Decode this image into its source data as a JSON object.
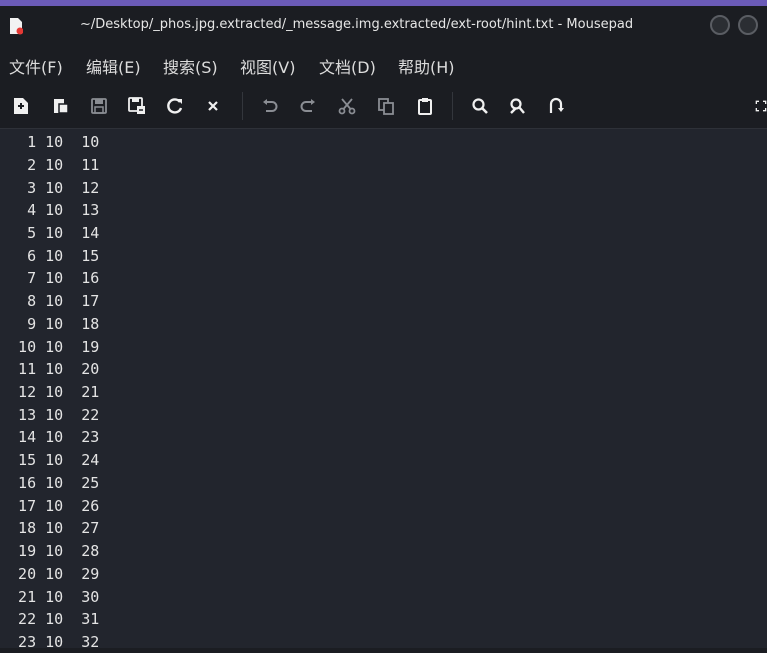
{
  "window": {
    "title": "~/Desktop/_phos.jpg.extracted/_message.img.extracted/ext-root/hint.txt - Mousepad"
  },
  "menu": [
    {
      "label": "文件(F)"
    },
    {
      "label": "编辑(E)"
    },
    {
      "label": "搜索(S)"
    },
    {
      "label": "视图(V)"
    },
    {
      "label": "文档(D)"
    },
    {
      "label": "帮助(H)"
    }
  ],
  "toolbar": {
    "icons": [
      "new-document-icon",
      "open-file-icon",
      "save-icon",
      "save-as-icon",
      "reload-icon",
      "close-icon",
      "undo-icon",
      "redo-icon",
      "cut-icon",
      "copy-icon",
      "paste-icon",
      "find-icon",
      "find-replace-icon",
      "go-to-line-icon",
      "fullscreen-icon"
    ]
  },
  "editor": {
    "lines": [
      "   1 10  10",
      "   2 10  11",
      "   3 10  12",
      "   4 10  13",
      "   5 10  14",
      "   6 10  15",
      "   7 10  16",
      "   8 10  17",
      "   9 10  18",
      "  10 10  19",
      "  11 10  20",
      "  12 10  21",
      "  13 10  22",
      "  14 10  23",
      "  15 10  24",
      "  16 10  25",
      "  17 10  26",
      "  18 10  27",
      "  19 10  28",
      "  20 10  29",
      "  21 10  30",
      "  22 10  31",
      "  23 10  32"
    ]
  },
  "colors": {
    "accent": "#6b5bb8",
    "background": "#22252d",
    "chrome": "#1b1d22",
    "text": "#e4e4e4"
  }
}
